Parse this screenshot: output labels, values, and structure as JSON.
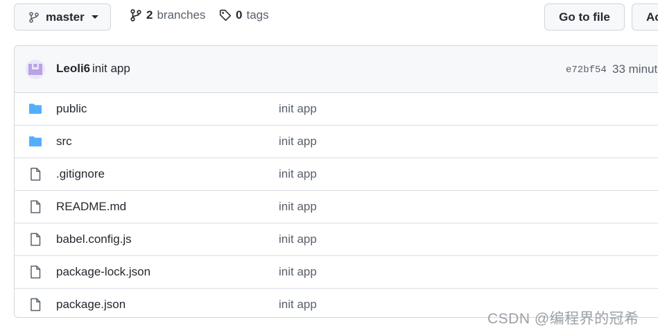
{
  "toolbar": {
    "branch_label": "master",
    "branches_count": "2",
    "branches_label": "branches",
    "tags_count": "0",
    "tags_label": "tags",
    "go_to_file": "Go to file",
    "add_file": "Ac"
  },
  "commit": {
    "author": "Leoli6",
    "message": "init app",
    "sha": "e72bf54",
    "time": "33 minut"
  },
  "files": [
    {
      "name": "public",
      "type": "folder",
      "commit": "init app"
    },
    {
      "name": "src",
      "type": "folder",
      "commit": "init app"
    },
    {
      "name": ".gitignore",
      "type": "file",
      "commit": "init app"
    },
    {
      "name": "README.md",
      "type": "file",
      "commit": "init app"
    },
    {
      "name": "babel.config.js",
      "type": "file",
      "commit": "init app"
    },
    {
      "name": "package-lock.json",
      "type": "file",
      "commit": "init app"
    },
    {
      "name": "package.json",
      "type": "file",
      "commit": "init app"
    }
  ],
  "colors": {
    "folder": "#54aeff",
    "border": "#d0d7de",
    "muted": "#57606a"
  },
  "watermark": "CSDN @编程界的冠希"
}
